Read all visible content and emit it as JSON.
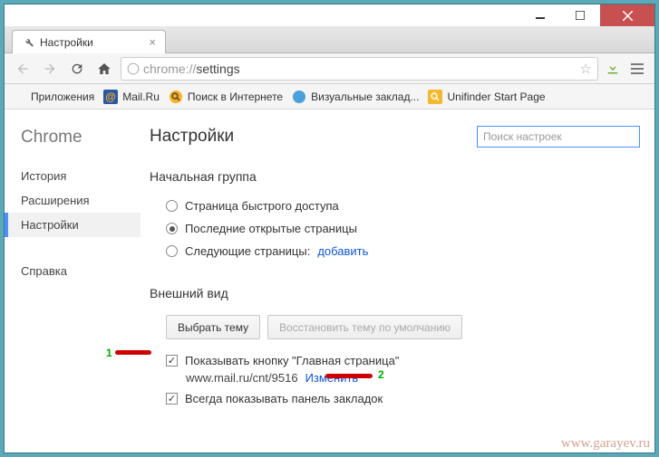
{
  "window": {
    "tab_title": "Настройки",
    "url_scheme": "chrome://",
    "url_path": "settings"
  },
  "bookmarks": {
    "apps": "Приложения",
    "items": [
      "Mail.Ru",
      "Поиск в Интернете",
      "Визуальные заклад...",
      "Unifinder Start Page"
    ]
  },
  "sidebar": {
    "brand": "Chrome",
    "history": "История",
    "extensions": "Расширения",
    "settings": "Настройки",
    "help": "Справка"
  },
  "page": {
    "title": "Настройки",
    "search_placeholder": "Поиск настроек"
  },
  "startup": {
    "heading": "Начальная группа",
    "opt_newtab": "Страница быстрого доступа",
    "opt_continue": "Последние открытые страницы",
    "opt_specific": "Следующие страницы:",
    "add_link": "добавить"
  },
  "appearance": {
    "heading": "Внешний вид",
    "choose_theme": "Выбрать тему",
    "reset_theme": "Восстановить тему по умолчанию",
    "show_home": "Показывать кнопку \"Главная страница\"",
    "home_url": "www.mail.ru/cnt/9516",
    "change": "Изменить",
    "show_bookmarks": "Всегда показывать панель закладок"
  },
  "annotations": {
    "one": "1",
    "two": "2"
  },
  "watermark": "www.garayev.ru"
}
